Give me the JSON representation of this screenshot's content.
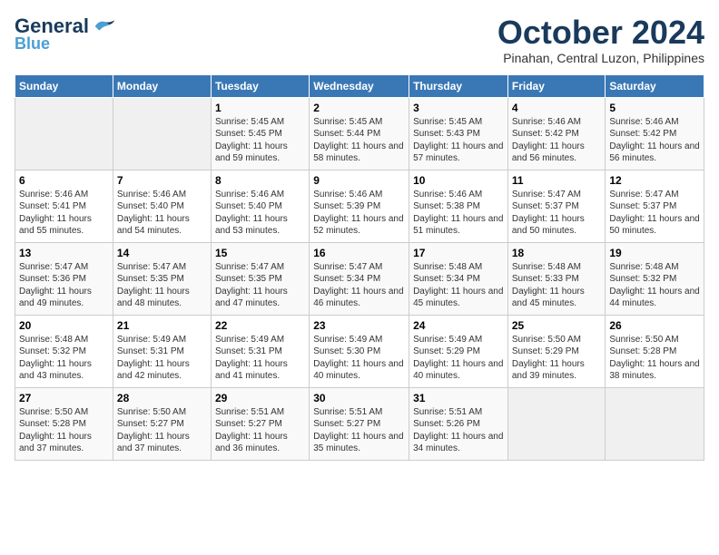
{
  "header": {
    "logo_general": "General",
    "logo_blue": "Blue",
    "month_title": "October 2024",
    "subtitle": "Pinahan, Central Luzon, Philippines"
  },
  "days_of_week": [
    "Sunday",
    "Monday",
    "Tuesday",
    "Wednesday",
    "Thursday",
    "Friday",
    "Saturday"
  ],
  "weeks": [
    [
      {
        "day": "",
        "sunrise": "",
        "sunset": "",
        "daylight": ""
      },
      {
        "day": "",
        "sunrise": "",
        "sunset": "",
        "daylight": ""
      },
      {
        "day": "1",
        "sunrise": "Sunrise: 5:45 AM",
        "sunset": "Sunset: 5:45 PM",
        "daylight": "Daylight: 11 hours and 59 minutes."
      },
      {
        "day": "2",
        "sunrise": "Sunrise: 5:45 AM",
        "sunset": "Sunset: 5:44 PM",
        "daylight": "Daylight: 11 hours and 58 minutes."
      },
      {
        "day": "3",
        "sunrise": "Sunrise: 5:45 AM",
        "sunset": "Sunset: 5:43 PM",
        "daylight": "Daylight: 11 hours and 57 minutes."
      },
      {
        "day": "4",
        "sunrise": "Sunrise: 5:46 AM",
        "sunset": "Sunset: 5:42 PM",
        "daylight": "Daylight: 11 hours and 56 minutes."
      },
      {
        "day": "5",
        "sunrise": "Sunrise: 5:46 AM",
        "sunset": "Sunset: 5:42 PM",
        "daylight": "Daylight: 11 hours and 56 minutes."
      }
    ],
    [
      {
        "day": "6",
        "sunrise": "Sunrise: 5:46 AM",
        "sunset": "Sunset: 5:41 PM",
        "daylight": "Daylight: 11 hours and 55 minutes."
      },
      {
        "day": "7",
        "sunrise": "Sunrise: 5:46 AM",
        "sunset": "Sunset: 5:40 PM",
        "daylight": "Daylight: 11 hours and 54 minutes."
      },
      {
        "day": "8",
        "sunrise": "Sunrise: 5:46 AM",
        "sunset": "Sunset: 5:40 PM",
        "daylight": "Daylight: 11 hours and 53 minutes."
      },
      {
        "day": "9",
        "sunrise": "Sunrise: 5:46 AM",
        "sunset": "Sunset: 5:39 PM",
        "daylight": "Daylight: 11 hours and 52 minutes."
      },
      {
        "day": "10",
        "sunrise": "Sunrise: 5:46 AM",
        "sunset": "Sunset: 5:38 PM",
        "daylight": "Daylight: 11 hours and 51 minutes."
      },
      {
        "day": "11",
        "sunrise": "Sunrise: 5:47 AM",
        "sunset": "Sunset: 5:37 PM",
        "daylight": "Daylight: 11 hours and 50 minutes."
      },
      {
        "day": "12",
        "sunrise": "Sunrise: 5:47 AM",
        "sunset": "Sunset: 5:37 PM",
        "daylight": "Daylight: 11 hours and 50 minutes."
      }
    ],
    [
      {
        "day": "13",
        "sunrise": "Sunrise: 5:47 AM",
        "sunset": "Sunset: 5:36 PM",
        "daylight": "Daylight: 11 hours and 49 minutes."
      },
      {
        "day": "14",
        "sunrise": "Sunrise: 5:47 AM",
        "sunset": "Sunset: 5:35 PM",
        "daylight": "Daylight: 11 hours and 48 minutes."
      },
      {
        "day": "15",
        "sunrise": "Sunrise: 5:47 AM",
        "sunset": "Sunset: 5:35 PM",
        "daylight": "Daylight: 11 hours and 47 minutes."
      },
      {
        "day": "16",
        "sunrise": "Sunrise: 5:47 AM",
        "sunset": "Sunset: 5:34 PM",
        "daylight": "Daylight: 11 hours and 46 minutes."
      },
      {
        "day": "17",
        "sunrise": "Sunrise: 5:48 AM",
        "sunset": "Sunset: 5:34 PM",
        "daylight": "Daylight: 11 hours and 45 minutes."
      },
      {
        "day": "18",
        "sunrise": "Sunrise: 5:48 AM",
        "sunset": "Sunset: 5:33 PM",
        "daylight": "Daylight: 11 hours and 45 minutes."
      },
      {
        "day": "19",
        "sunrise": "Sunrise: 5:48 AM",
        "sunset": "Sunset: 5:32 PM",
        "daylight": "Daylight: 11 hours and 44 minutes."
      }
    ],
    [
      {
        "day": "20",
        "sunrise": "Sunrise: 5:48 AM",
        "sunset": "Sunset: 5:32 PM",
        "daylight": "Daylight: 11 hours and 43 minutes."
      },
      {
        "day": "21",
        "sunrise": "Sunrise: 5:49 AM",
        "sunset": "Sunset: 5:31 PM",
        "daylight": "Daylight: 11 hours and 42 minutes."
      },
      {
        "day": "22",
        "sunrise": "Sunrise: 5:49 AM",
        "sunset": "Sunset: 5:31 PM",
        "daylight": "Daylight: 11 hours and 41 minutes."
      },
      {
        "day": "23",
        "sunrise": "Sunrise: 5:49 AM",
        "sunset": "Sunset: 5:30 PM",
        "daylight": "Daylight: 11 hours and 40 minutes."
      },
      {
        "day": "24",
        "sunrise": "Sunrise: 5:49 AM",
        "sunset": "Sunset: 5:29 PM",
        "daylight": "Daylight: 11 hours and 40 minutes."
      },
      {
        "day": "25",
        "sunrise": "Sunrise: 5:50 AM",
        "sunset": "Sunset: 5:29 PM",
        "daylight": "Daylight: 11 hours and 39 minutes."
      },
      {
        "day": "26",
        "sunrise": "Sunrise: 5:50 AM",
        "sunset": "Sunset: 5:28 PM",
        "daylight": "Daylight: 11 hours and 38 minutes."
      }
    ],
    [
      {
        "day": "27",
        "sunrise": "Sunrise: 5:50 AM",
        "sunset": "Sunset: 5:28 PM",
        "daylight": "Daylight: 11 hours and 37 minutes."
      },
      {
        "day": "28",
        "sunrise": "Sunrise: 5:50 AM",
        "sunset": "Sunset: 5:27 PM",
        "daylight": "Daylight: 11 hours and 37 minutes."
      },
      {
        "day": "29",
        "sunrise": "Sunrise: 5:51 AM",
        "sunset": "Sunset: 5:27 PM",
        "daylight": "Daylight: 11 hours and 36 minutes."
      },
      {
        "day": "30",
        "sunrise": "Sunrise: 5:51 AM",
        "sunset": "Sunset: 5:27 PM",
        "daylight": "Daylight: 11 hours and 35 minutes."
      },
      {
        "day": "31",
        "sunrise": "Sunrise: 5:51 AM",
        "sunset": "Sunset: 5:26 PM",
        "daylight": "Daylight: 11 hours and 34 minutes."
      },
      {
        "day": "",
        "sunrise": "",
        "sunset": "",
        "daylight": ""
      },
      {
        "day": "",
        "sunrise": "",
        "sunset": "",
        "daylight": ""
      }
    ]
  ]
}
